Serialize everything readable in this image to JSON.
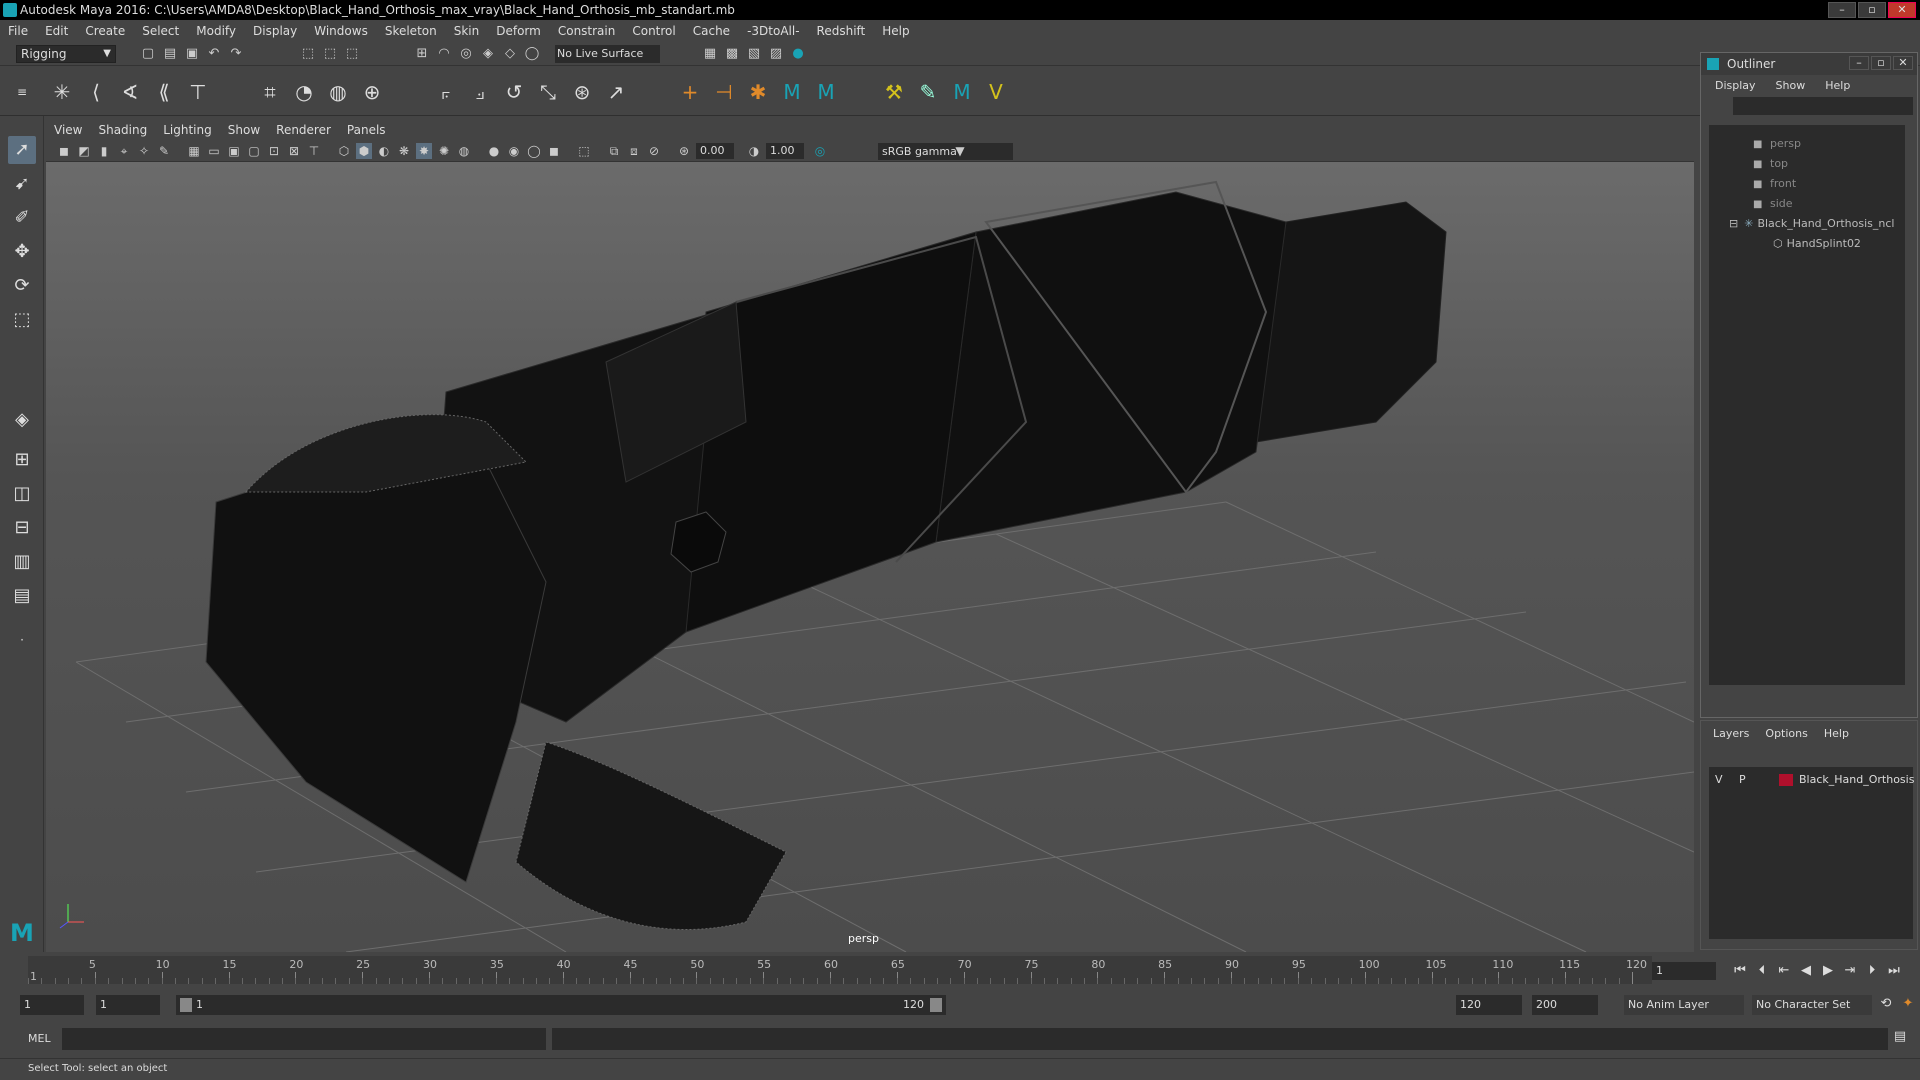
{
  "window": {
    "title": "Autodesk Maya 2016: C:\\Users\\AMDA8\\Desktop\\Black_Hand_Orthosis_max_vray\\Black_Hand_Orthosis_mb_standart.mb"
  },
  "menubar": [
    "File",
    "Edit",
    "Create",
    "Select",
    "Modify",
    "Display",
    "Windows",
    "Skeleton",
    "Skin",
    "Deform",
    "Constrain",
    "Control",
    "Cache",
    "-3DtoAll-",
    "Redshift",
    "Help"
  ],
  "statusline": {
    "mode": "Rigging",
    "live_surface": "No Live Surface"
  },
  "viewport": {
    "menu": [
      "View",
      "Shading",
      "Lighting",
      "Show",
      "Renderer",
      "Panels"
    ],
    "exposure": "0.00",
    "gamma_value": "1.00",
    "color_space": "sRGB gamma",
    "camera_label": "persp"
  },
  "outliner": {
    "title": "Outliner",
    "menu": [
      "Display",
      "Show",
      "Help"
    ],
    "cameras": [
      "persp",
      "top",
      "front",
      "side"
    ],
    "group": "Black_Hand_Orthosis_ncl",
    "child": "HandSplint02"
  },
  "layers": {
    "menu": [
      "Layers",
      "Options",
      "Help"
    ],
    "row": {
      "v": "V",
      "p": "P",
      "name": "Black_Hand_Orthosis",
      "color": "#b0102c"
    }
  },
  "timeline": {
    "ticks": [
      "5",
      "10",
      "15",
      "20",
      "25",
      "30",
      "35",
      "40",
      "45",
      "50",
      "55",
      "60",
      "65",
      "70",
      "75",
      "80",
      "85",
      "90",
      "95",
      "100",
      "105",
      "110",
      "115",
      "120"
    ],
    "start_marker": "1",
    "current_frame": "1"
  },
  "range": {
    "start": "1",
    "anim_start": "1",
    "slider_start": "1",
    "slider_end": "120",
    "end": "120",
    "anim_end": "200",
    "anim_layer": "No Anim Layer",
    "char_set": "No Character Set"
  },
  "cmd": {
    "label": "MEL"
  },
  "help": {
    "text": "Select Tool: select an object"
  }
}
